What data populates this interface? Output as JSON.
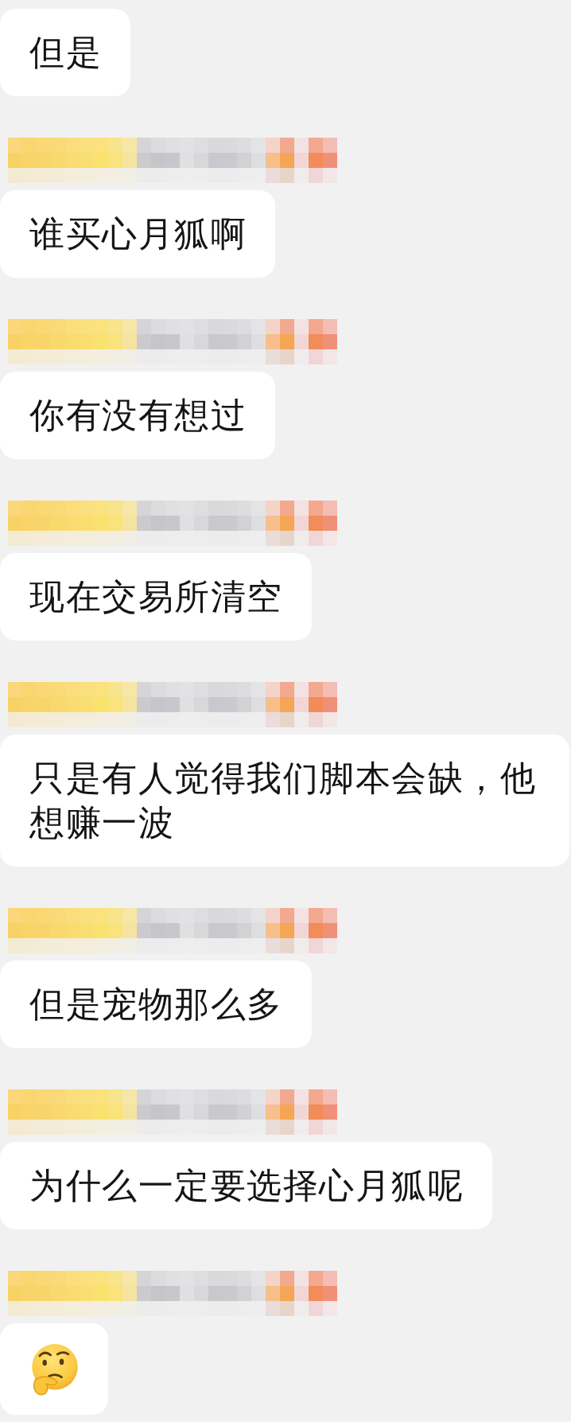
{
  "chat": {
    "items": [
      {
        "kind": "text",
        "text": "但是"
      },
      {
        "kind": "hidden_sender"
      },
      {
        "kind": "text",
        "text": "谁买心月狐啊"
      },
      {
        "kind": "hidden_sender"
      },
      {
        "kind": "text",
        "text": "你有没有想过"
      },
      {
        "kind": "hidden_sender"
      },
      {
        "kind": "text",
        "text": "现在交易所清空"
      },
      {
        "kind": "hidden_sender"
      },
      {
        "kind": "text",
        "text": "只是有人觉得我们脚本会缺，他想赚一波"
      },
      {
        "kind": "hidden_sender"
      },
      {
        "kind": "text",
        "text": "但是宠物那么多"
      },
      {
        "kind": "hidden_sender"
      },
      {
        "kind": "text",
        "text": "为什么一定要选择心月狐呢"
      },
      {
        "kind": "hidden_sender"
      },
      {
        "kind": "emoji"
      }
    ]
  }
}
